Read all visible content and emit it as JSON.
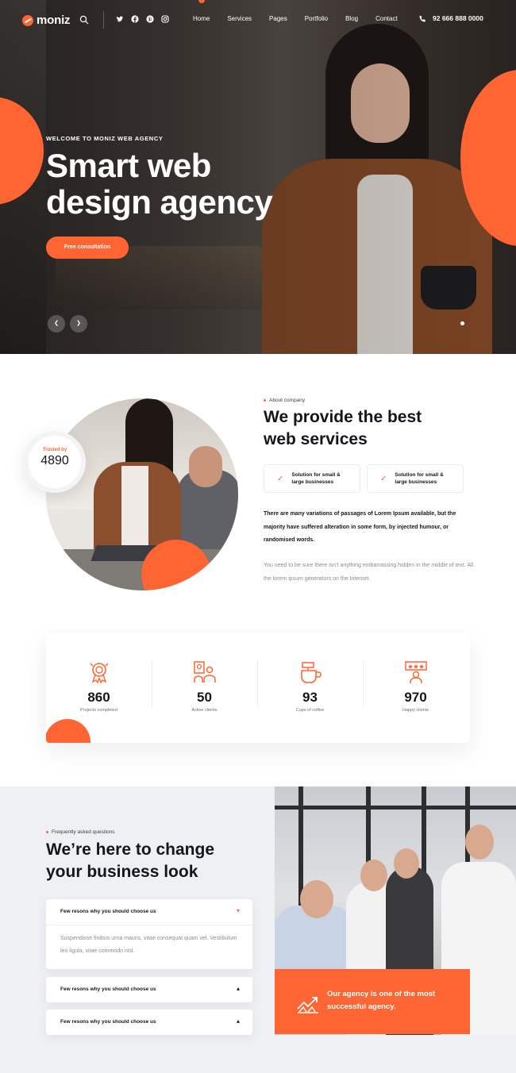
{
  "brand": {
    "name": "moniz",
    "accent": "#ff6433"
  },
  "header": {
    "search_icon": "search-icon",
    "socials": [
      "twitter-icon",
      "facebook-icon",
      "pinterest-icon",
      "instagram-icon"
    ],
    "nav": [
      "Home",
      "Services",
      "Pages",
      "Portfolio",
      "Blog",
      "Contact"
    ],
    "phone": "92 666 888 0000"
  },
  "hero": {
    "eyebrow": "WELCOME TO MONIZ WEB AGENCY",
    "title_line1": "Smart web",
    "title_line2": "design agency",
    "cta": "Free consultation",
    "prev_icon": "arrow-left-icon",
    "next_icon": "arrow-right-icon"
  },
  "about": {
    "trusted_label": "Trusted by",
    "trusted_value": "4890",
    "eyebrow": "About company",
    "title_line1": "We provide the best",
    "title_line2": "web services",
    "features": [
      {
        "line1": "Solution for small &",
        "line2": "large businesses"
      },
      {
        "line1": "Solution for small &",
        "line2": "large businesses"
      }
    ],
    "strong_text": "There are many variations of passages of Lorem Ipsum available, but the majority have suffered alteration in some form, by injected humour, or randomised words.",
    "muted_text": "You need to be sure there isn't anything embarrassing hidden in the middle of text. All the lorem ipsum generators on the Internet."
  },
  "stats": [
    {
      "value": "860",
      "label": "Projects completed",
      "icon": "award-icon"
    },
    {
      "value": "50",
      "label": "Active clients",
      "icon": "team-presentation-icon"
    },
    {
      "value": "93",
      "label": "Cups of coffee",
      "icon": "coffee-icon"
    },
    {
      "value": "970",
      "label": "Happy clients",
      "icon": "rating-stars-icon"
    }
  ],
  "faq": {
    "eyebrow": "Frequently asked questions",
    "title_line1": "We’re here to change",
    "title_line2": "your business look",
    "items": [
      {
        "question": "Few resons why you should choose us",
        "answer": "Suspendisse finibus urna mauris, vitae consequat quam vel. Vestibulum leo ligula, vitae commodo nisl.",
        "open": true
      },
      {
        "question": "Few resons why you should choose us",
        "open": false
      },
      {
        "question": "Few resons why you should choose us",
        "open": false
      }
    ],
    "agency_text": "Our agency is one of the most successful agency."
  }
}
